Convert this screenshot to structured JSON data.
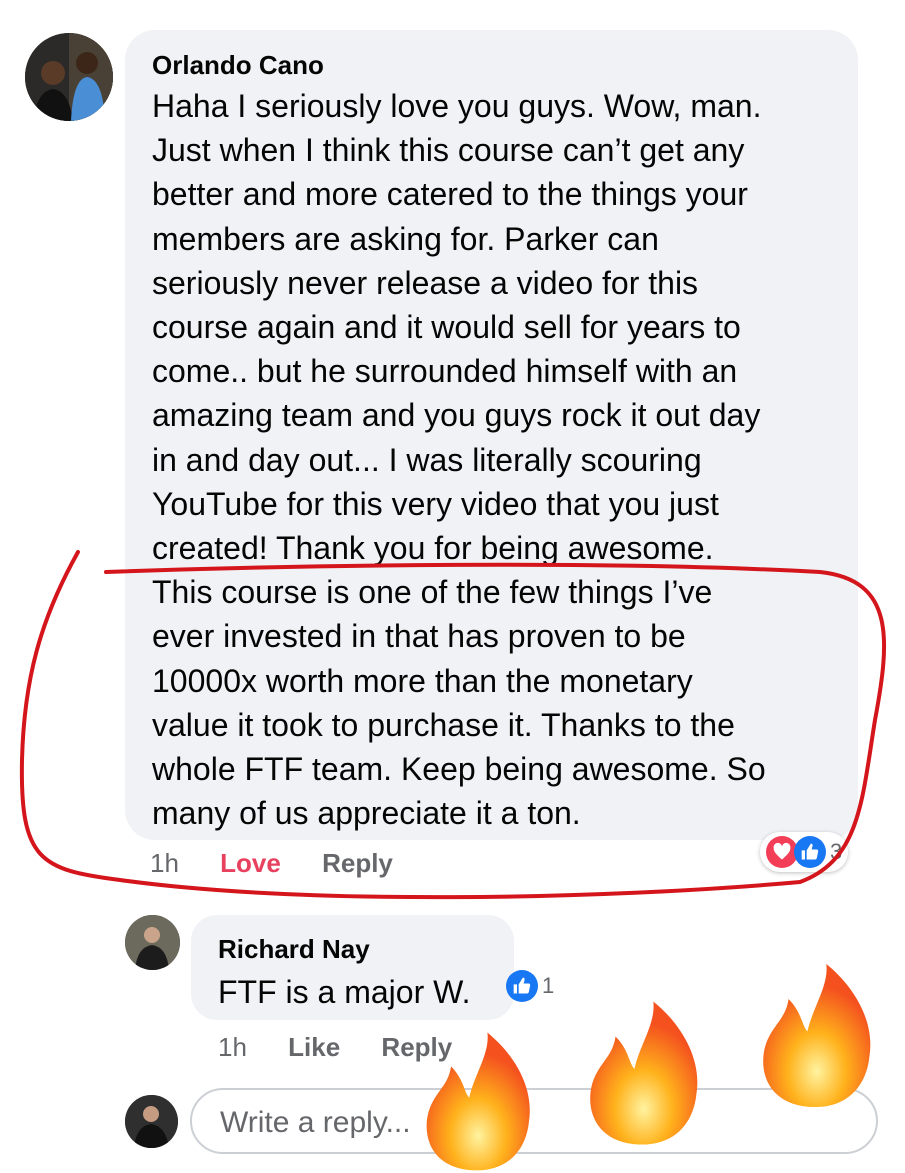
{
  "comment": {
    "author": "Orlando Cano",
    "text": "Haha I seriously love you guys. Wow, man.\nJust when I think this course can’t get any\nbetter and more catered to the things your\nmembers are asking for. Parker can\nseriously never release a video for this\ncourse again and it would sell for years to\ncome.. but he surrounded himself with an\namazing team and you guys rock it out day\nin and day out... I was literally scouring\nYouTube for this very video that you just\ncreated! Thank you for being awesome.\nThis course is one of the few things I’ve\never invested in that has proven to be\n10000x worth more than the monetary\nvalue it took to purchase it. Thanks to the\nwhole FTF team. Keep being awesome. So\nmany of us appreciate it a ton.",
    "time": "1h",
    "reaction_action": "Love",
    "reply_label": "Reply",
    "reaction_count": "3",
    "reaction_icons": [
      "heart-icon",
      "thumbs-up-icon"
    ]
  },
  "reply": {
    "author": "Richard Nay",
    "text": "FTF is a major W.",
    "time": "1h",
    "like_label": "Like",
    "reply_label": "Reply",
    "reaction_count": "1",
    "reaction_icons": [
      "thumbs-up-icon"
    ]
  },
  "composer": {
    "placeholder": "Write a reply..."
  },
  "colors": {
    "bubble": "#f0f2f5",
    "love": "#e8415f",
    "like_blue": "#1877f2",
    "annotation_red": "#d4161c",
    "meta_gray": "#65676b"
  }
}
